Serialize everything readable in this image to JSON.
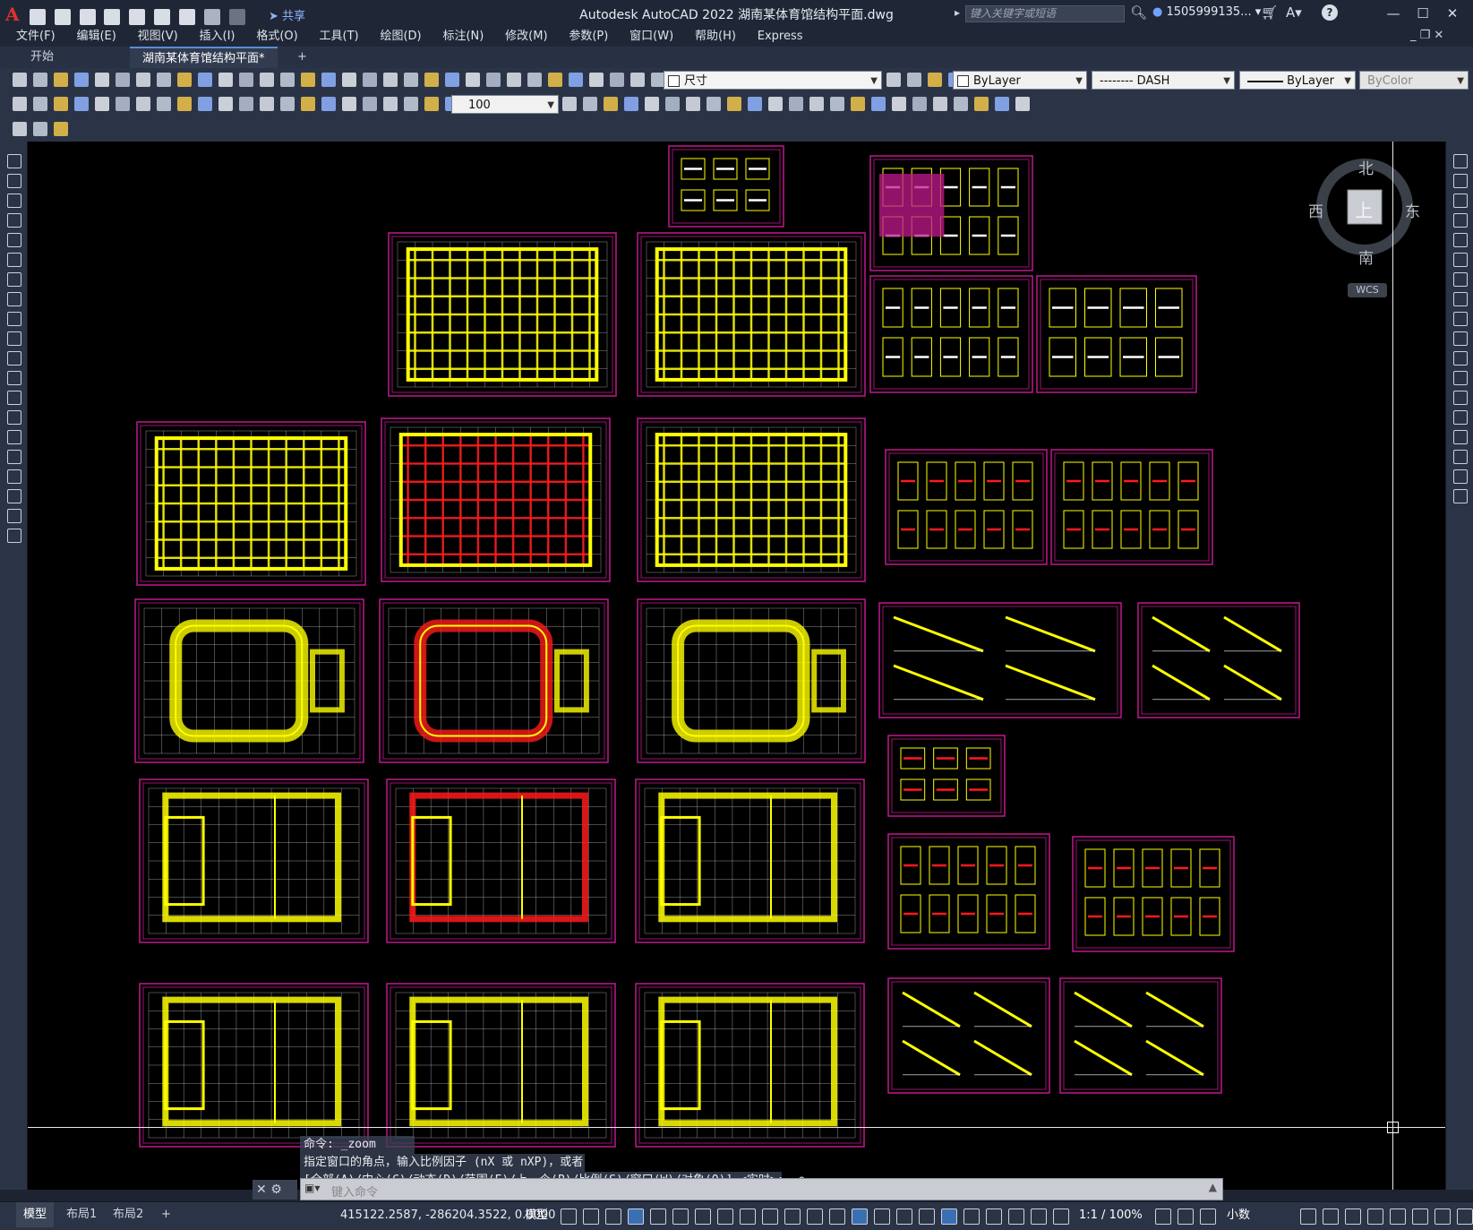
{
  "app": {
    "title": "Autodesk AutoCAD 2022    湖南某体育馆结构平面.dwg",
    "logo": "A",
    "share_label": "共享",
    "search_placeholder": "键入关键字或短语",
    "user": "1505999135...",
    "help": "?"
  },
  "menu": [
    "文件(F)",
    "编辑(E)",
    "视图(V)",
    "插入(I)",
    "格式(O)",
    "工具(T)",
    "绘图(D)",
    "标注(N)",
    "修改(M)",
    "参数(P)",
    "窗口(W)",
    "帮助(H)",
    "Express"
  ],
  "tabs": {
    "start": "开始",
    "active": "湖南某体育馆结构平面*",
    "add": "+"
  },
  "toolbar": {
    "layer_name": "尺寸",
    "color": "ByLayer",
    "linetype": "-------- DASH",
    "lineweight": "ByLayer",
    "plotstyle": "ByColor",
    "dimscale": "100"
  },
  "viewcube": {
    "north": "北",
    "south": "南",
    "east": "东",
    "west": "西",
    "top": "上",
    "wcs": "WCS"
  },
  "command": {
    "history": [
      "命令:  _zoom",
      "指定窗口的角点，输入比例因子 (nX 或 nXP)，或者",
      "[全部(A)/中心(C)/动态(D)/范围(E)/上一个(P)/比例(S)/窗口(W)/对象(O)] <实时>:  _e"
    ],
    "placeholder": "键入命令"
  },
  "status": {
    "layouts": [
      "模型",
      "布局1",
      "布局2"
    ],
    "add": "+",
    "coords": "415122.2587, -286204.3522, 0.0000",
    "space": "模型",
    "scale": "1:1 / 100%",
    "units": "小数"
  },
  "colors": {
    "canvas": "#000000",
    "sheet_border": "#c0198c",
    "beam_yellow": "#ffff00",
    "beam_red": "#ff1a1a",
    "grid": "#ffffff"
  }
}
